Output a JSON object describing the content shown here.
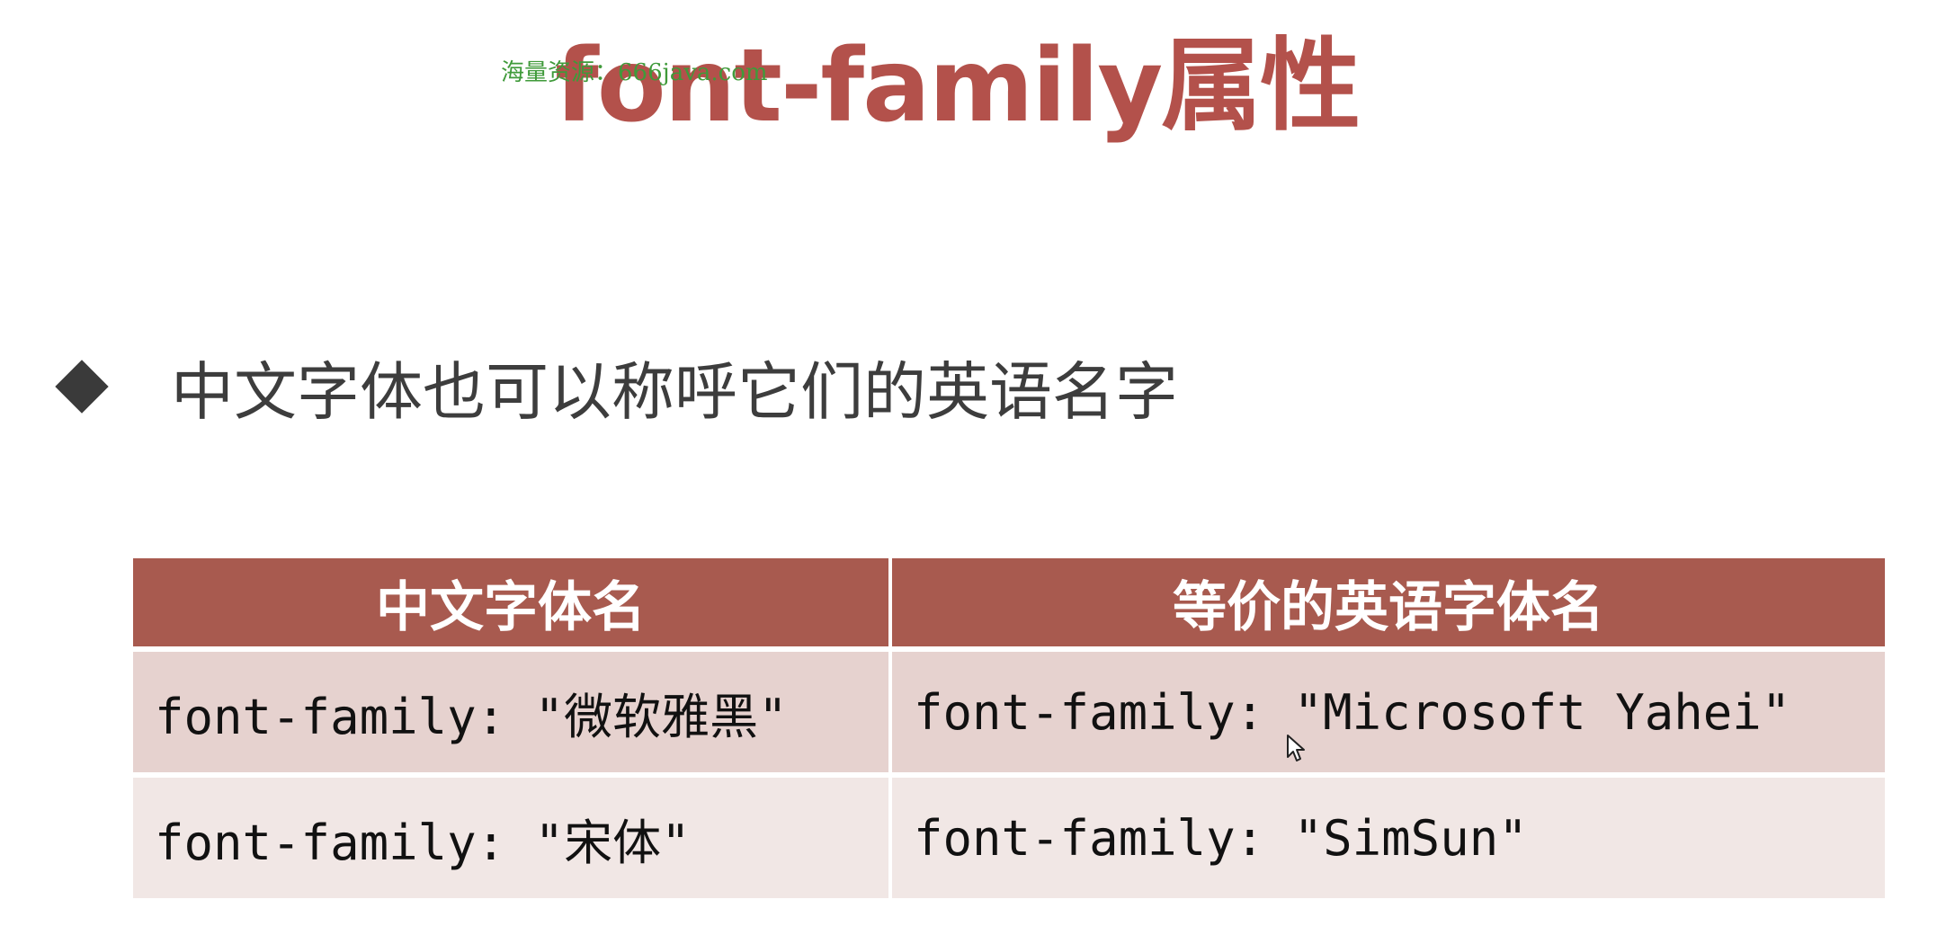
{
  "slide": {
    "watermark": "海量资源：666java.com",
    "title": "font-family属性",
    "bullet": {
      "icon": "diamond-bullet-icon",
      "text": "中文字体也可以称呼它们的英语名字"
    }
  },
  "table": {
    "headers": [
      "中文字体名",
      "等价的英语字体名"
    ],
    "rows": [
      [
        "font-family: \"微软雅黑\"",
        "font-family: \"Microsoft Yahei\""
      ],
      [
        "font-family: \"宋体\"",
        "font-family: \"SimSun\""
      ]
    ]
  },
  "colors": {
    "title": "#b3514b",
    "header_bg": "#a85a4f",
    "row_odd_bg": "#e6d2cf",
    "row_even_bg": "#f1e7e5",
    "watermark": "#3f9a3a"
  },
  "icons": {
    "pointer": "mouse-pointer-icon"
  }
}
